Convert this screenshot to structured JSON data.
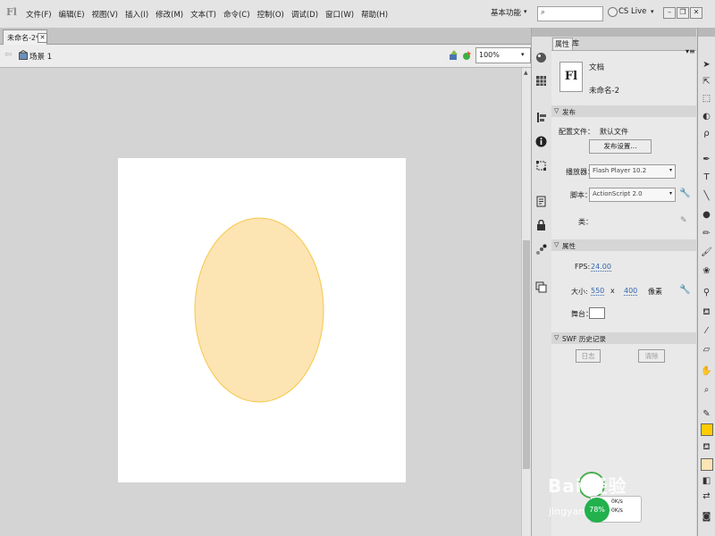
{
  "app": {
    "logo": "Fl"
  },
  "menu": [
    "文件(F)",
    "编辑(E)",
    "视图(V)",
    "插入(I)",
    "修改(M)",
    "文本(T)",
    "命令(C)",
    "控制(O)",
    "调试(D)",
    "窗口(W)",
    "帮助(H)"
  ],
  "toolbar": {
    "workspace": "基本功能",
    "search_placeholder": "",
    "cslive": "CS Live"
  },
  "document": {
    "tab_title": "未命名-2*",
    "scene": "场景 1",
    "zoom": "100%"
  },
  "stage": {
    "background": "#ffffff",
    "ellipse_fill": "#fde4b3",
    "ellipse_stroke": "#f6c84a"
  },
  "panel": {
    "tabs": [
      "属性",
      "库"
    ],
    "doc_type_icon": "Fl",
    "doc_type": "文档",
    "doc_name": "未命名-2",
    "publish": {
      "section": "发布",
      "profile_label": "配置文件：",
      "profile_value": "默认文件",
      "settings_button": "发布设置...",
      "player_label": "播放器：",
      "player_value": "Flash Player 10.2",
      "script_label": "脚本：",
      "script_value": "ActionScript 2.0",
      "class_label": "类："
    },
    "properties": {
      "section": "属性",
      "fps_label": "FPS:",
      "fps_value": "24.00",
      "size_label": "大小:",
      "width": "550",
      "x": "x",
      "height": "400",
      "unit": "像素",
      "stage_label": "舞台：",
      "stage_color": "#ffffff"
    },
    "swf_history": {
      "section": "SWF 历史记录",
      "log_button": "日志",
      "clear_button": "清除"
    }
  },
  "colors": {
    "stroke": "#ffcc00",
    "fill": "#fde4b3"
  },
  "watermark": {
    "logo": "Bai 经验",
    "sub": "jingyan.baidu.com"
  },
  "speed_badge": {
    "percent": "78%",
    "upload": "0K/s",
    "download": "0K/s"
  }
}
